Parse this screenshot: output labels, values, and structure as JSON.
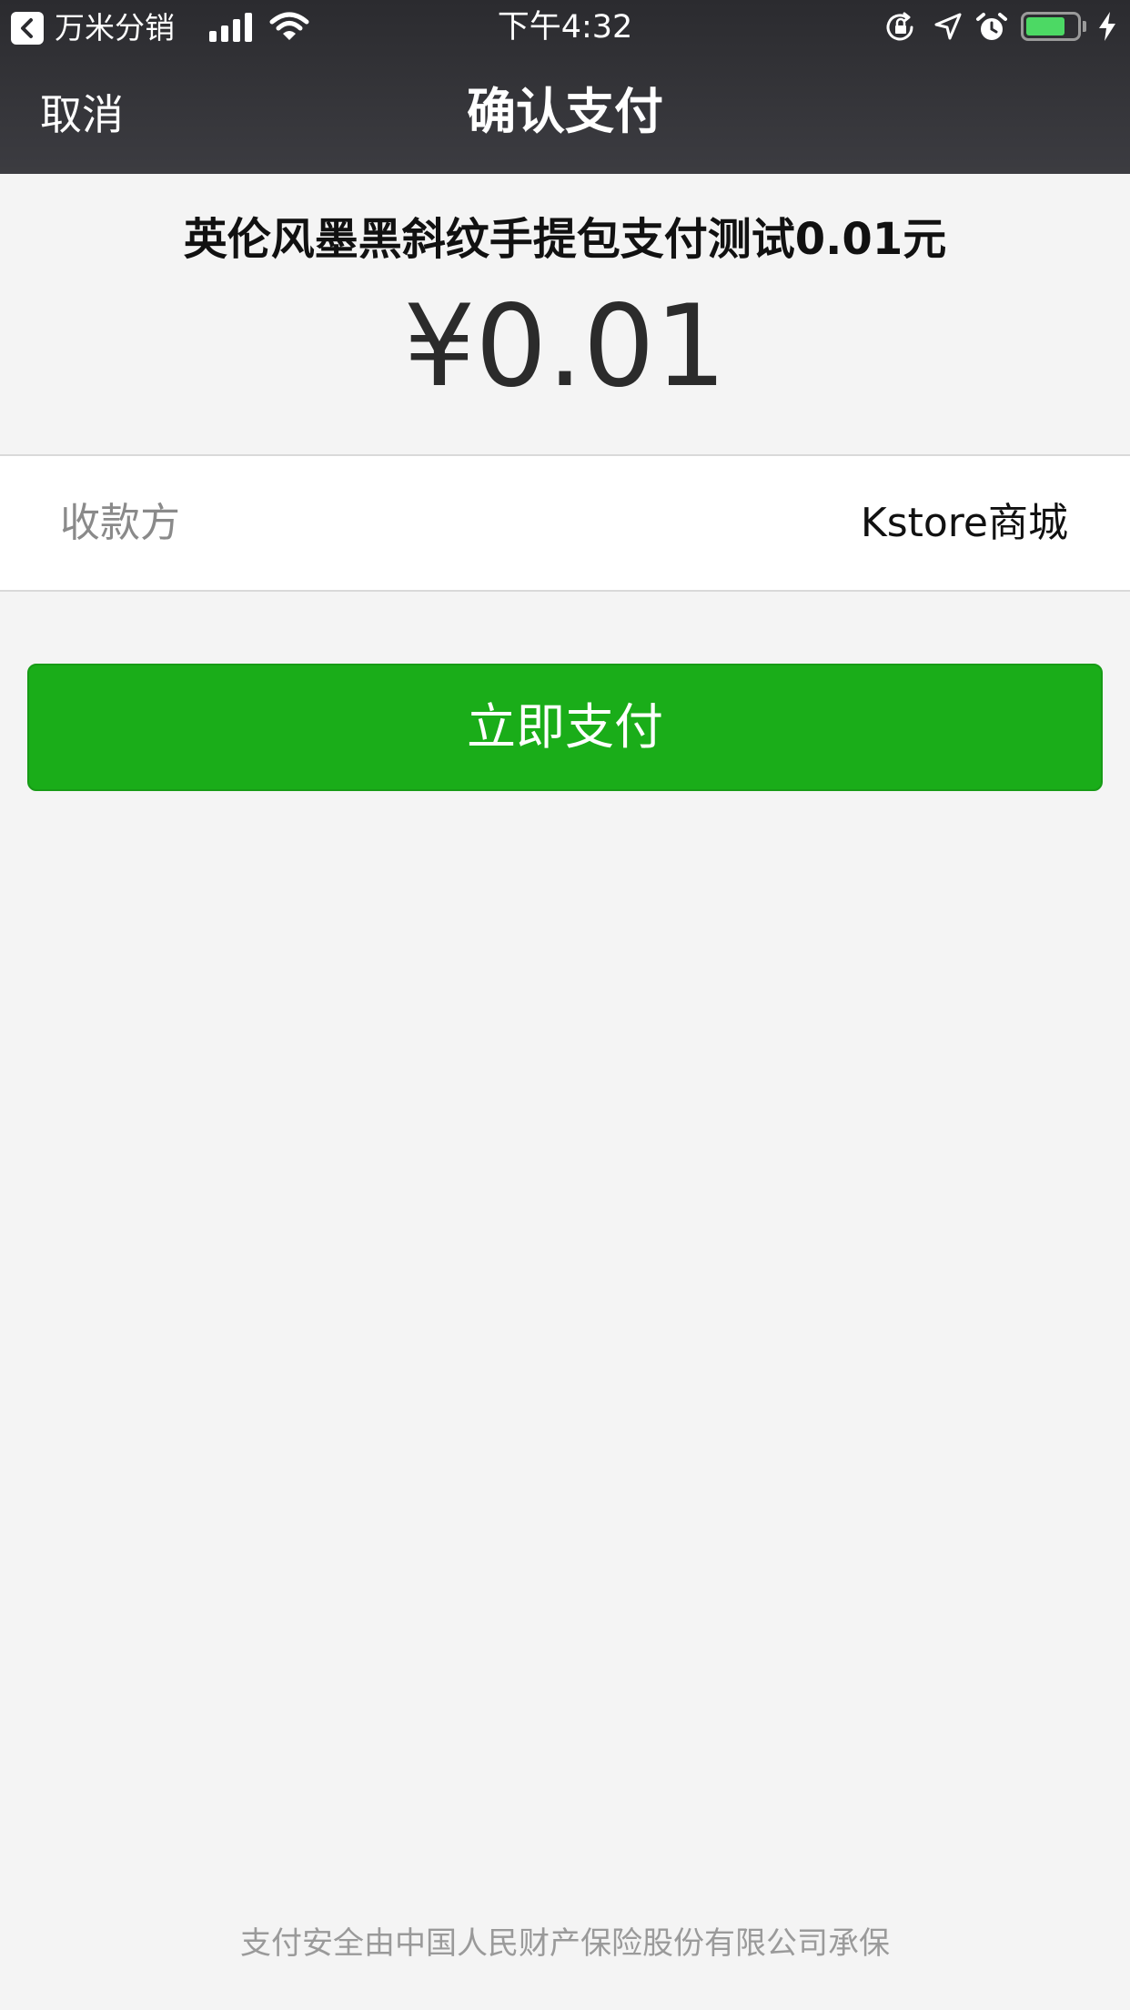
{
  "status_bar": {
    "back_app_label": "万米分销",
    "time": "下午4:32",
    "battery_level": 0.8,
    "battery_color": "#4cd964",
    "icons": [
      "back-arrow-icon",
      "signal-icon",
      "wifi-icon",
      "orientation-lock-icon",
      "location-icon",
      "alarm-icon",
      "battery-icon",
      "charging-icon"
    ]
  },
  "nav": {
    "cancel_label": "取消",
    "title": "确认支付"
  },
  "order": {
    "product_name": "英伦风墨黑斜纹手提包支付测试0.01元",
    "amount": "¥0.01"
  },
  "payee": {
    "label": "收款方",
    "value": "Kstore商城"
  },
  "pay_button": {
    "label": "立即支付",
    "color": "#1aad19"
  },
  "footer": {
    "note": "支付安全由中国人民财产保险股份有限公司承保"
  }
}
